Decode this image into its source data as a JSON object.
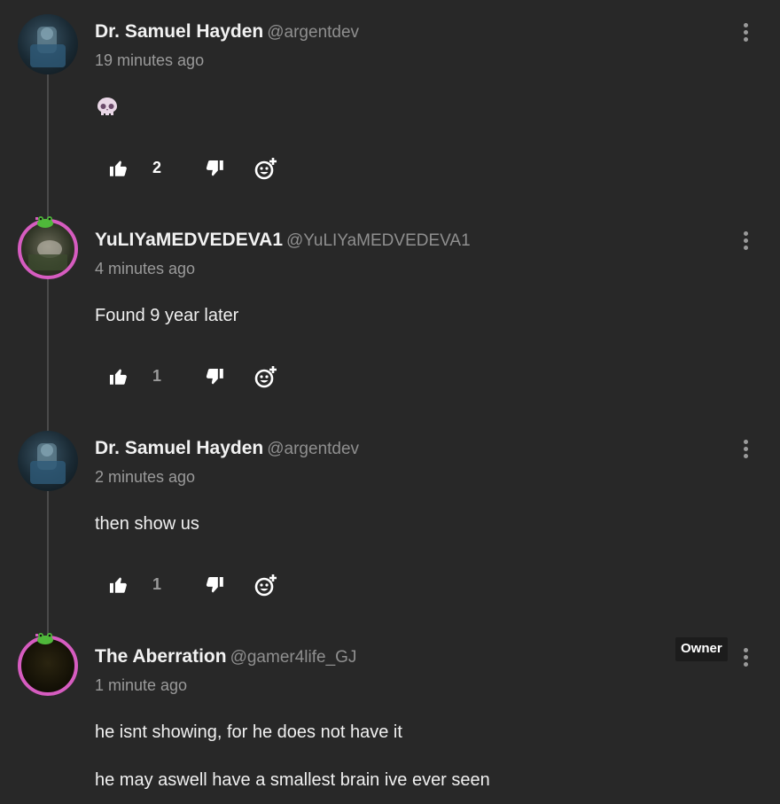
{
  "colors": {
    "background": "#282828",
    "ring": "#d65cc0",
    "muted": "#9a9a9a"
  },
  "comments": [
    {
      "author": "Dr. Samuel Hayden",
      "handle": "@argentdev",
      "time": "19 minutes ago",
      "body": [
        "💀"
      ],
      "likes": "2",
      "likes_bold": true,
      "owner": false
    },
    {
      "author": "YuLIYaMEDVEDEVA1",
      "handle": "@YuLIYaMEDVEDEVA1",
      "time": "4 minutes ago",
      "body": [
        "Found 9 year later"
      ],
      "likes": "1",
      "likes_bold": false,
      "owner": false
    },
    {
      "author": "Dr. Samuel Hayden",
      "handle": "@argentdev",
      "time": "2 minutes ago",
      "body": [
        "then show us"
      ],
      "likes": "1",
      "likes_bold": false,
      "owner": false
    },
    {
      "author": "The Aberration",
      "handle": "@gamer4life_GJ",
      "time": "1 minute ago",
      "body": [
        "he isnt showing, for he does not have it",
        "he may aswell have a smallest brain ive ever seen"
      ],
      "owner_label": "Owner",
      "owner": true
    }
  ],
  "icons": {
    "like": "thumbs-up-icon",
    "dislike": "thumbs-down-icon",
    "react": "add-reaction-icon",
    "menu": "kebab-menu-icon",
    "emoji": "skull-emoji-icon"
  }
}
